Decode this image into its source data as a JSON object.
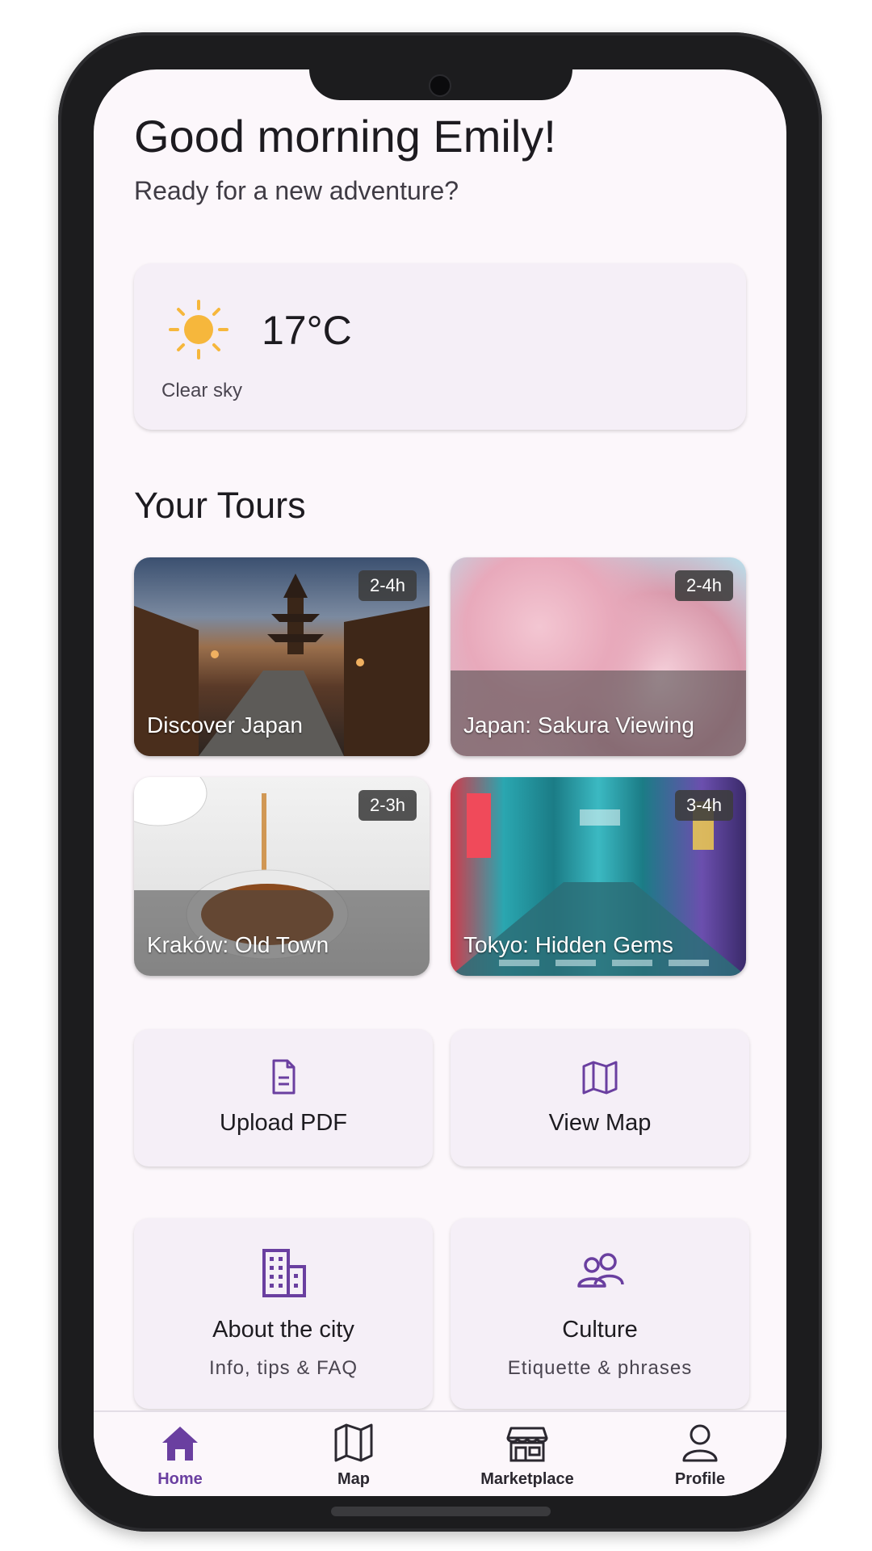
{
  "greeting": {
    "title": "Good morning Emily!",
    "subtitle": "Ready for a new adventure?"
  },
  "weather": {
    "icon": "sun-icon",
    "temperature": "17°C",
    "condition": "Clear sky"
  },
  "tours_section": {
    "title": "Your Tours"
  },
  "tours": [
    {
      "name": "Discover Japan",
      "duration": "2-4h"
    },
    {
      "name": "Japan: Sakura Viewing",
      "duration": "2-4h"
    },
    {
      "name": "Kraków: Old Town",
      "duration": "2-3h"
    },
    {
      "name": "Tokyo: Hidden Gems",
      "duration": "3-4h"
    }
  ],
  "actions": [
    {
      "label": "Upload PDF",
      "icon": "document-icon"
    },
    {
      "label": "View Map",
      "icon": "map-icon"
    }
  ],
  "info_cards": [
    {
      "title": "About the city",
      "subtitle": "Info, tips & FAQ",
      "icon": "building-icon"
    },
    {
      "title": "Culture",
      "subtitle": "Etiquette & phrases",
      "icon": "people-icon"
    }
  ],
  "nav": [
    {
      "label": "Home",
      "icon": "home-icon",
      "active": true
    },
    {
      "label": "Map",
      "icon": "map-icon"
    },
    {
      "label": "Marketplace",
      "icon": "store-icon"
    },
    {
      "label": "Profile",
      "icon": "person-icon"
    }
  ],
  "colors": {
    "accent": "#6a3fa0",
    "card_bg": "#f5eff7",
    "screen_bg": "#fcf7fb",
    "sun": "#f6b73c"
  }
}
